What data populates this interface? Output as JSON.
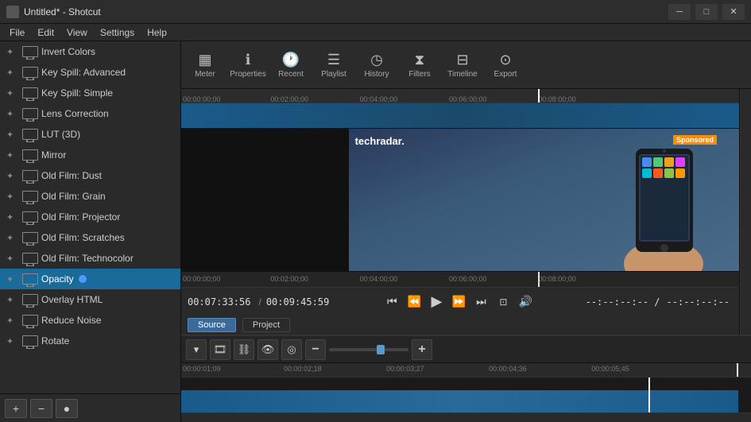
{
  "titlebar": {
    "title": "Untitled* - Shotcut",
    "icon": "●",
    "minimize": "─",
    "maximize": "□",
    "close": "✕"
  },
  "menubar": {
    "items": [
      "File",
      "Edit",
      "View",
      "Settings",
      "Help"
    ]
  },
  "toolbar": {
    "items": [
      {
        "id": "meter",
        "icon": "▦",
        "label": "Meter"
      },
      {
        "id": "properties",
        "icon": "ℹ",
        "label": "Properties"
      },
      {
        "id": "recent",
        "icon": "🕐",
        "label": "Recent"
      },
      {
        "id": "playlist",
        "icon": "☰",
        "label": "Playlist"
      },
      {
        "id": "history",
        "icon": "◷",
        "label": "History"
      },
      {
        "id": "filters",
        "icon": "⧗",
        "label": "Filters"
      },
      {
        "id": "timeline",
        "icon": "⊟",
        "label": "Timeline"
      },
      {
        "id": "export",
        "icon": "⊙",
        "label": "Export"
      }
    ]
  },
  "filters": {
    "items": [
      {
        "label": "Invert Colors",
        "selected": false
      },
      {
        "label": "Key Spill: Advanced",
        "selected": false
      },
      {
        "label": "Key Spill: Simple",
        "selected": false
      },
      {
        "label": "Lens Correction",
        "selected": false
      },
      {
        "label": "LUT (3D)",
        "selected": false
      },
      {
        "label": "Mirror",
        "selected": false
      },
      {
        "label": "Old Film: Dust",
        "selected": false
      },
      {
        "label": "Old Film: Grain",
        "selected": false
      },
      {
        "label": "Old Film: Projector",
        "selected": false
      },
      {
        "label": "Old Film: Scratches",
        "selected": false
      },
      {
        "label": "Old Film: Technocolor",
        "selected": false
      },
      {
        "label": "Opacity",
        "selected": true
      },
      {
        "label": "Overlay HTML",
        "selected": false
      },
      {
        "label": "Reduce Noise",
        "selected": false
      },
      {
        "label": "Rotate",
        "selected": false
      }
    ]
  },
  "sidebar_bottom": {
    "add_btn": "+",
    "remove_btn": "−",
    "record_btn": "●"
  },
  "timeline_ruler": {
    "ticks": [
      {
        "time": "00:00:00;00",
        "pos": "0%"
      },
      {
        "time": "00:02:00;00",
        "pos": "16%"
      },
      {
        "time": "00:04:00;00",
        "pos": "32%"
      },
      {
        "time": "00:06:00;00",
        "pos": "48%"
      },
      {
        "time": "00:08:00;00",
        "pos": "64%"
      }
    ]
  },
  "video": {
    "overlay_text": "techradar.",
    "sponsor_text": "Sponsored"
  },
  "player": {
    "current_time": "00:07:33:56",
    "total_time": "00:09:45:59",
    "separator": "/",
    "skip_back_btn": "⏮",
    "rewind_btn": "⏪",
    "play_btn": "▶",
    "forward_btn": "⏩",
    "skip_fwd_btn": "⏭",
    "frame_btn": "⊡",
    "volume_btn": "🔊",
    "timecode_display": "--:--:--:-- /",
    "timecode_display2": "--:--:--:--"
  },
  "source_tabs": {
    "source_label": "Source",
    "project_label": "Project"
  },
  "bottom_ruler": {
    "ticks": [
      {
        "time": "00:00:01;09",
        "pos": "0%"
      },
      {
        "time": "00:00:02;18",
        "pos": "18%"
      },
      {
        "time": "00:00:03;27",
        "pos": "36%"
      },
      {
        "time": "00:00:04;36",
        "pos": "54%"
      },
      {
        "time": "00:00:05;45",
        "pos": "72%"
      }
    ]
  },
  "timeline_toolbar": {
    "chevron_down": "▾",
    "film_btn": "🎞",
    "chain_btn": "⛓",
    "eye_btn": "👁",
    "target_btn": "◎",
    "zoom_out": "−",
    "zoom_in": "+",
    "zoom_value": 60
  }
}
